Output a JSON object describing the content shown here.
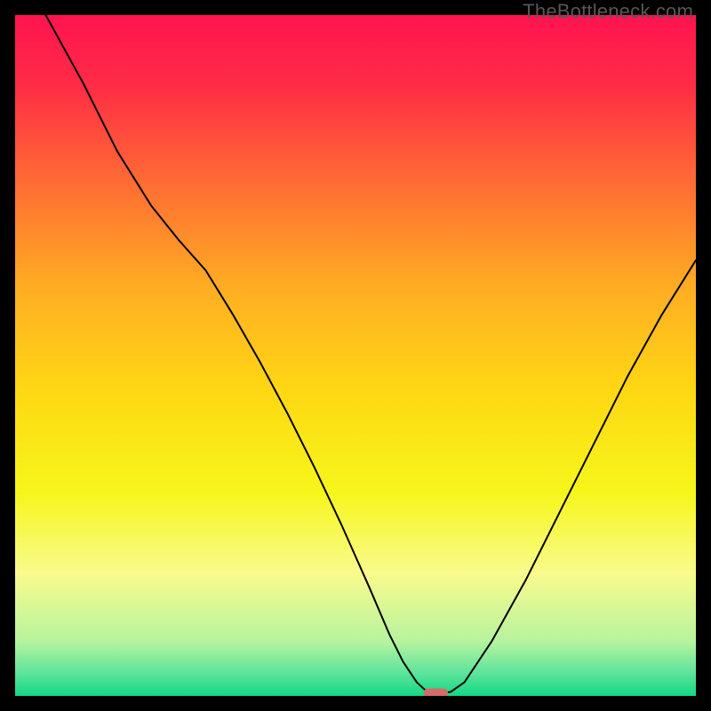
{
  "watermark": "TheBottleneck.com",
  "chart_data": {
    "type": "line",
    "title": "",
    "xlabel": "",
    "ylabel": "",
    "xlim": [
      0,
      100
    ],
    "ylim": [
      0,
      100
    ],
    "grid": false,
    "legend": false,
    "background_gradient": {
      "stops": [
        {
          "offset": 0.0,
          "color": "#ff1450"
        },
        {
          "offset": 0.1,
          "color": "#ff2b46"
        },
        {
          "offset": 0.25,
          "color": "#ff6d33"
        },
        {
          "offset": 0.4,
          "color": "#ffad23"
        },
        {
          "offset": 0.55,
          "color": "#ffd714"
        },
        {
          "offset": 0.7,
          "color": "#f6f61a"
        },
        {
          "offset": 0.82,
          "color": "#f9fb8d"
        },
        {
          "offset": 0.92,
          "color": "#b7f39e"
        },
        {
          "offset": 0.965,
          "color": "#5fe59c"
        },
        {
          "offset": 1.0,
          "color": "#14d883"
        }
      ]
    },
    "series": [
      {
        "name": "bottleneck-curve",
        "stroke": "#000000",
        "stroke_width": 2,
        "x": [
          4.5,
          10,
          15,
          20,
          24,
          28,
          32,
          36,
          40,
          44,
          48,
          52,
          55,
          57,
          59,
          60.5,
          62,
          63,
          64,
          66,
          70,
          75,
          80,
          85,
          90,
          95,
          100
        ],
        "values": [
          100,
          90,
          80,
          72,
          67,
          62.5,
          56,
          49,
          41.5,
          33.5,
          25,
          16,
          9,
          5,
          2,
          0.6,
          0.4,
          0.4,
          0.6,
          2,
          8,
          17,
          27,
          37,
          47,
          56,
          64
        ]
      }
    ],
    "marker": {
      "name": "optimal-marker",
      "x": 61.8,
      "y": 0.45,
      "width_pct": 3.6,
      "height_pct": 1.3,
      "color": "#d46a6a"
    }
  }
}
